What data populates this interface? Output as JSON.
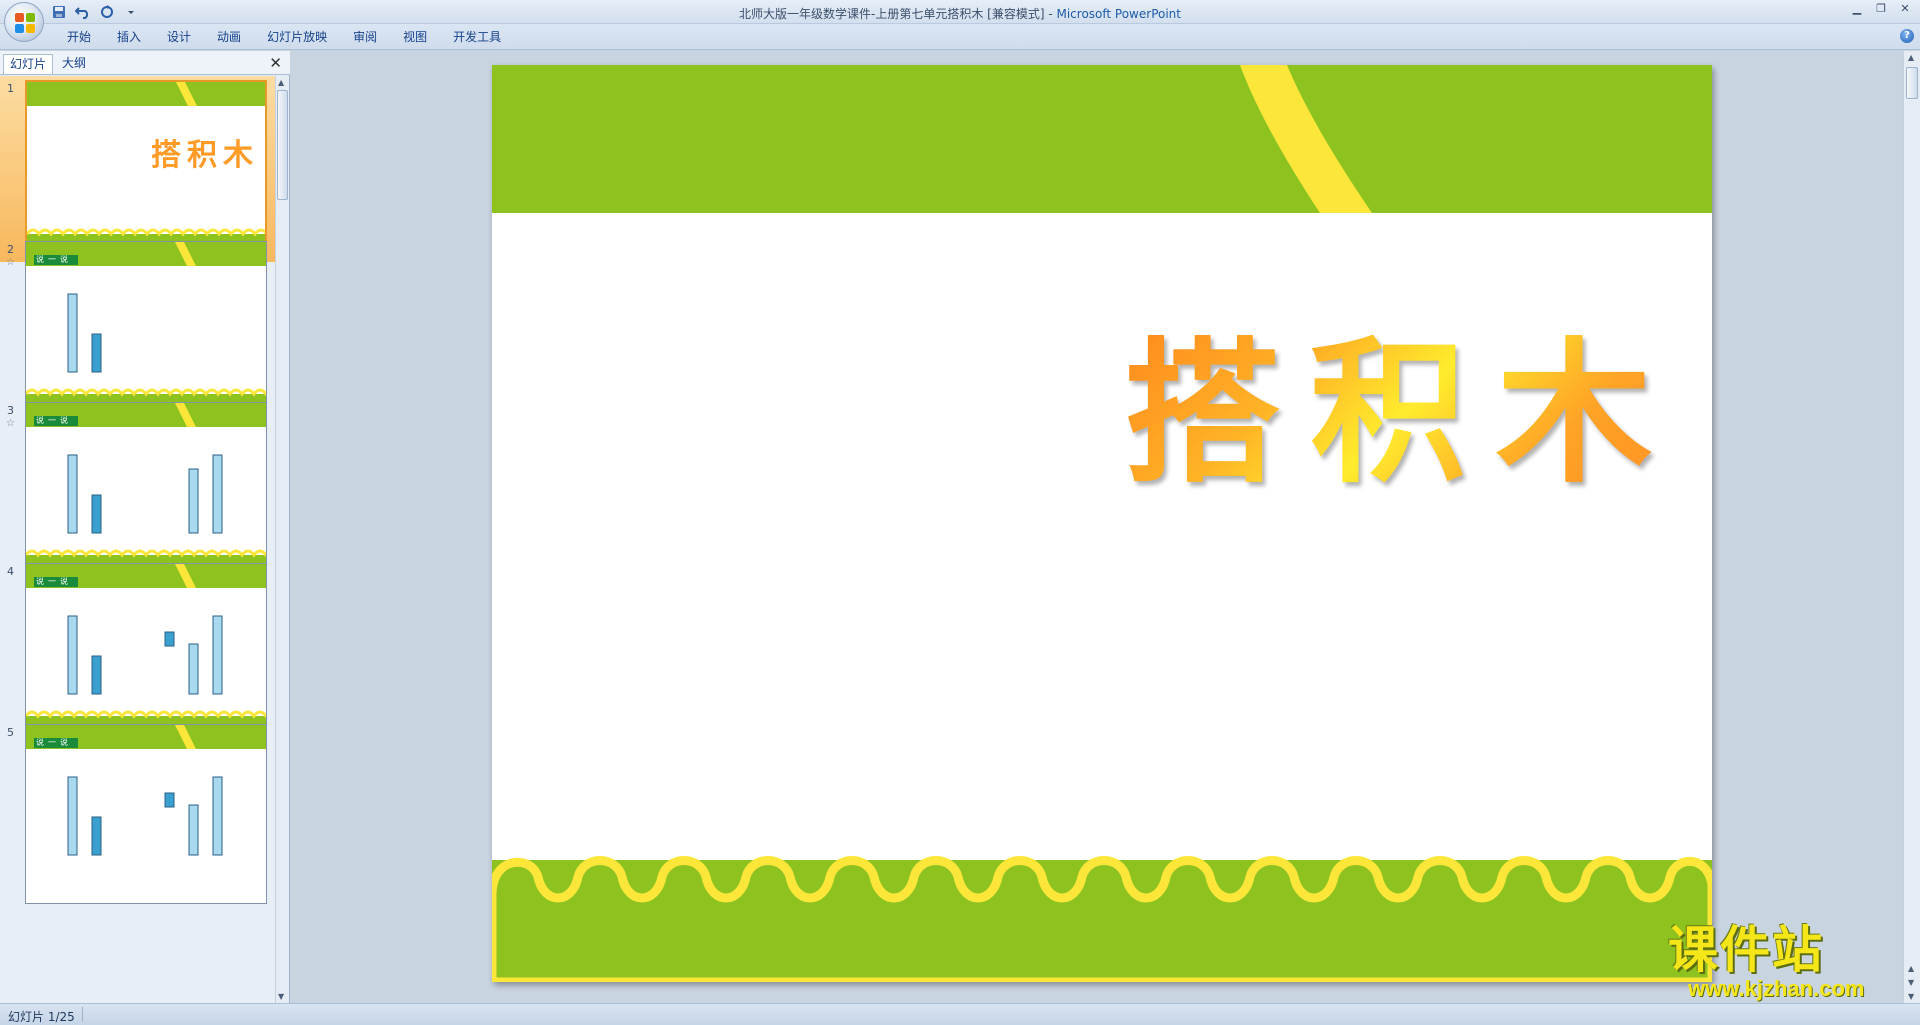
{
  "window": {
    "title": "北师大版一年级数学课件-上册第七单元搭积木 [兼容模式]",
    "title_sep": " - ",
    "app": "Microsoft PowerPoint"
  },
  "qat": {
    "icons": [
      "save-icon",
      "undo-icon",
      "redo-icon",
      "customize-icon"
    ]
  },
  "ribbon": {
    "tabs": [
      "开始",
      "插入",
      "设计",
      "动画",
      "幻灯片放映",
      "审阅",
      "视图",
      "开发工具"
    ]
  },
  "pane": {
    "tab_slides": "幻灯片",
    "tab_outline": "大纲",
    "close": "✕"
  },
  "thumbnails": [
    {
      "num": "1",
      "title": "搭积木"
    },
    {
      "num": "2",
      "label": "说一说"
    },
    {
      "num": "3",
      "label": "说一说"
    },
    {
      "num": "4",
      "label": "说一说"
    },
    {
      "num": "5",
      "label": "说一说"
    }
  ],
  "slide": {
    "title": "搭积木"
  },
  "watermark": {
    "cn": "课件站",
    "url": "www.kjzhan.com"
  },
  "status": {
    "slide_count": "幻灯片 1/25"
  },
  "colors": {
    "green": "#8dc21f",
    "yellow": "#fde63a",
    "orange": "#ff9b26"
  }
}
